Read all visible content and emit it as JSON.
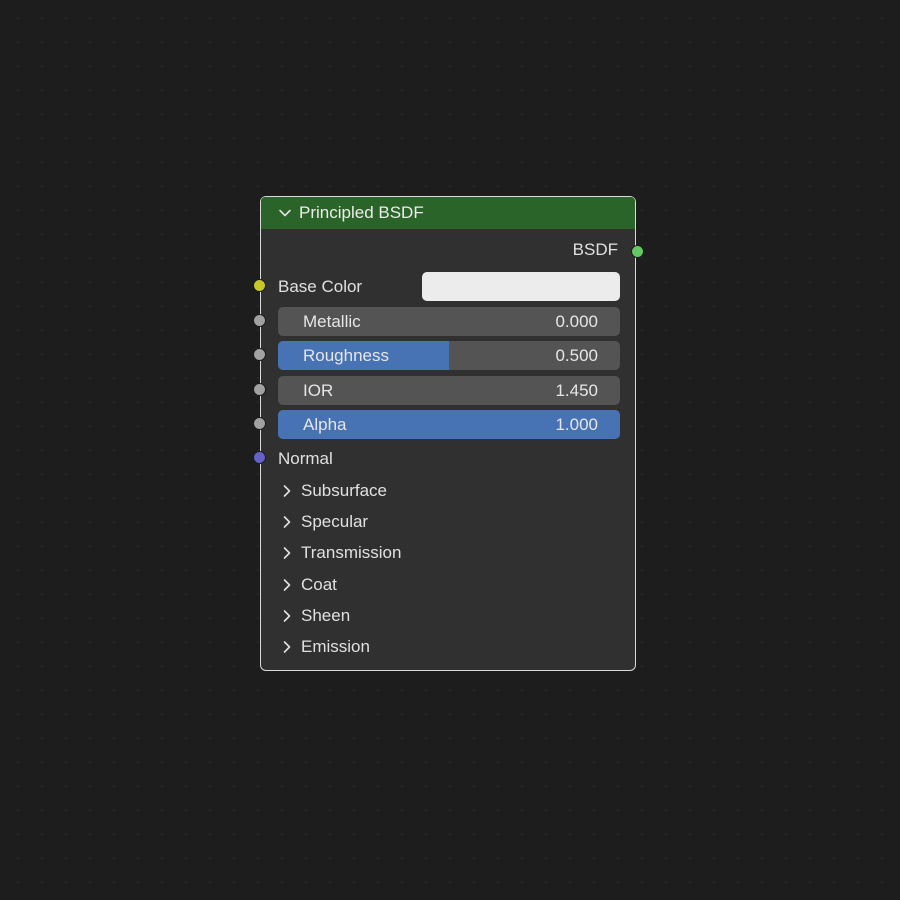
{
  "node": {
    "title": "Principled BSDF",
    "header_color": "#2a6428",
    "output": {
      "label": "BSDF",
      "socket_color": "#63c763"
    },
    "inputs": {
      "base_color": {
        "label": "Base Color",
        "socket_color": "#c7c729",
        "swatch_color": "#ececec"
      },
      "metallic": {
        "label": "Metallic",
        "value": "0.000",
        "fill_fraction": 0.0,
        "socket_color": "#a1a1a1"
      },
      "roughness": {
        "label": "Roughness",
        "value": "0.500",
        "fill_fraction": 0.5,
        "socket_color": "#a1a1a1"
      },
      "ior": {
        "label": "IOR",
        "value": "1.450",
        "fill_fraction": 0.0,
        "socket_color": "#a1a1a1"
      },
      "alpha": {
        "label": "Alpha",
        "value": "1.000",
        "fill_fraction": 1.0,
        "socket_color": "#a1a1a1"
      },
      "normal": {
        "label": "Normal",
        "socket_color": "#6363c7"
      }
    },
    "panels": [
      {
        "label": "Subsurface",
        "icon": "chevron-right-icon"
      },
      {
        "label": "Specular",
        "icon": "chevron-right-icon"
      },
      {
        "label": "Transmission",
        "icon": "chevron-right-icon"
      },
      {
        "label": "Coat",
        "icon": "chevron-right-icon"
      },
      {
        "label": "Sheen",
        "icon": "chevron-right-icon"
      },
      {
        "label": "Emission",
        "icon": "chevron-right-icon"
      }
    ],
    "header_icon": "chevron-down-icon",
    "slider_fill_color": "#4772b3",
    "slider_bg_color": "#545454"
  }
}
